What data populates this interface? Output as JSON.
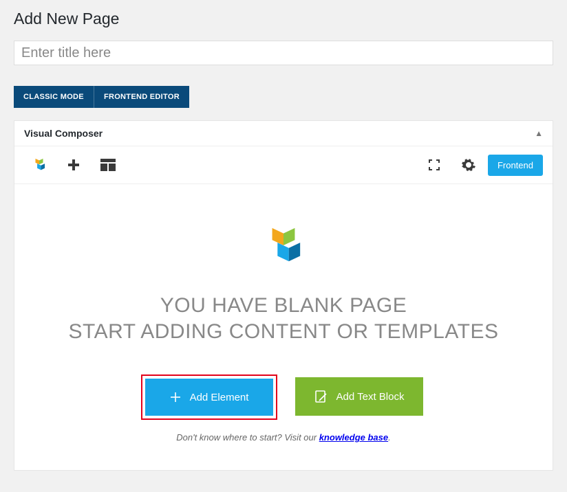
{
  "page": {
    "heading": "Add New Page",
    "title_placeholder": "Enter title here"
  },
  "modes": {
    "classic": "CLASSIC MODE",
    "frontend": "FRONTEND EDITOR"
  },
  "panel": {
    "title": "Visual Composer"
  },
  "toolbar": {
    "frontend_btn": "Frontend"
  },
  "blank": {
    "line1": "YOU HAVE BLANK PAGE",
    "line2": "START ADDING CONTENT OR TEMPLATES",
    "add_element": "Add Element",
    "add_text_block": "Add Text Block",
    "hint_prefix": "Don't know where to start? Visit our ",
    "hint_kb": "knowledge base",
    "hint_suffix": "."
  }
}
